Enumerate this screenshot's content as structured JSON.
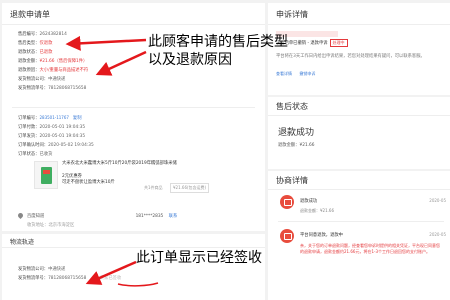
{
  "left_panel": {
    "title": "退款申请单",
    "fields": [
      {
        "label": "售后编号：",
        "value": "2624382814",
        "style": "val"
      },
      {
        "label": "售后类型：",
        "value": "仅退款",
        "style": "val-red"
      },
      {
        "label": "退款状态：",
        "value": "已退款",
        "style": "val-red"
      },
      {
        "label": "退款金额：",
        "value": "¥21.66（售后保障1件）",
        "style": "val-red"
      },
      {
        "label": "退款原因：",
        "value": "大小/重量与商品描述不符",
        "style": "val-red"
      },
      {
        "label": "发货物流公司：",
        "value": "中通快递",
        "style": "val"
      },
      {
        "label": "发货物流单号：",
        "value": "78128068715658",
        "style": "val"
      }
    ],
    "order": {
      "order_no_label": "订单编号：",
      "order_no": "283501-11767",
      "order_no_link": "复制",
      "paid_label": "订单付款：",
      "paid": "2020-05-01 19:04:35",
      "ship_label": "订单发货：",
      "ship": "2020-05-01 19:04:35",
      "confirm_label": "订单确认时间：",
      "confirm": "2020-05-02 19:04:35",
      "state_label": "订单状态：",
      "state": "已收货"
    },
    "product": {
      "title": "大米农北大米蠢博大米5斤10斤20斤袋2019年糯弧部珠米储",
      "subtitle": "2元优惠券",
      "note": "可走不盘状让盈博大米10斤",
      "qty": "共1件商品",
      "price": "¥21.66(包含运费)"
    },
    "address": {
      "name": "百度知道",
      "phone": "181****2835",
      "action": "联系",
      "detail": "收货地址：北京市海淀区"
    }
  },
  "logistics_panel": {
    "title": "物流轨迹",
    "company_label": "发货物流公司：",
    "company": "中通快递",
    "tracking_label": "发货物流单号：",
    "tracking": "78128068715658",
    "status": "买家已签收"
  },
  "right_panel_1": {
    "title": "申诉详情",
    "line1": "该售后单已撤销 - 退款申诉",
    "badge": "处理中",
    "line2": "平台将在3天工作日内给出申诉结果，若您对处理结果有疑问，可以联系客服。",
    "link1": "查看详情",
    "link2": "撤销申诉"
  },
  "right_panel_2": {
    "title": "售后状态",
    "status": "退款成功",
    "refund_label": "退款金额：",
    "refund_value": "¥21.66"
  },
  "right_panel_3": {
    "title": "协商详情",
    "items": [
      {
        "title": "退款成功",
        "date": "2020-05",
        "text": "退款金额：¥21.66"
      },
      {
        "title": "平台同意退款，退款中",
        "date": "2020-05",
        "text": "亲，关于您的订单退款问题，经查看您申诉时提供的相关凭证，平台现已同意您的退款申请，退款金额约21.66元，将在1-3个工作日退回您的支付账户。"
      }
    ]
  },
  "annotations": {
    "a1_line1": "此顾客申请的售后类型",
    "a1_line2": "以及退款原因",
    "a2": "此订单显示已经签收"
  }
}
